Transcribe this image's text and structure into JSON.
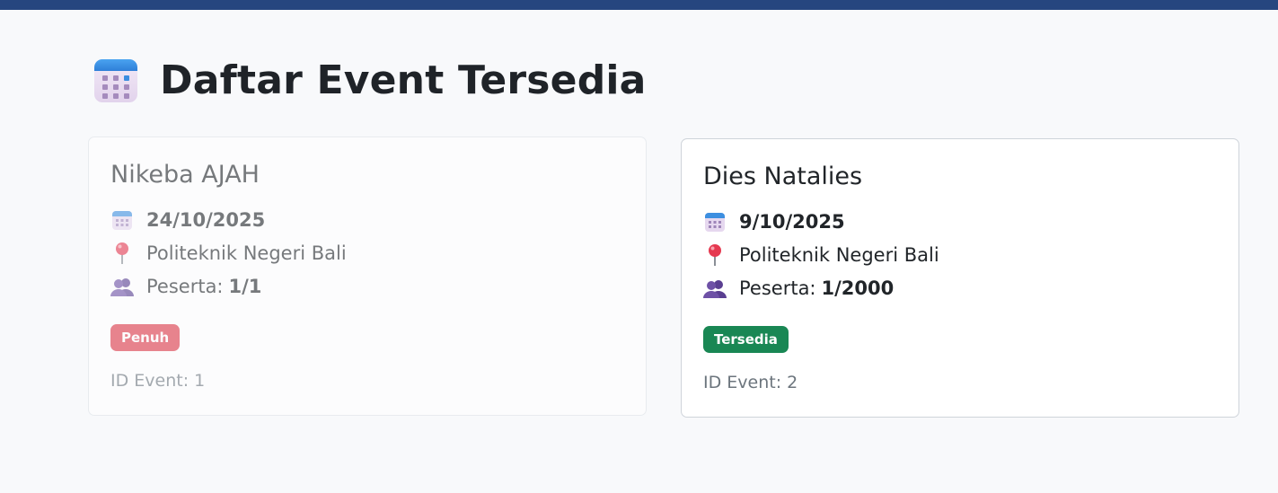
{
  "header": {
    "title": "Daftar Event Tersedia",
    "icon": "calendar-icon"
  },
  "colors": {
    "topbar": "#26467f",
    "badge_full": "#dc3545",
    "badge_available": "#198754"
  },
  "events": [
    {
      "name": "Nikeba AJAH",
      "date": "24/10/2025",
      "location": "Politeknik Negeri Bali",
      "participants_label": "Peserta:",
      "participants": "1/1",
      "status": "Penuh",
      "id_label": "ID Event: 1"
    },
    {
      "name": "Dies Natalies",
      "date": "9/10/2025",
      "location": "Politeknik Negeri Bali",
      "participants_label": "Peserta:",
      "participants": "1/2000",
      "status": "Tersedia",
      "id_label": "ID Event: 2"
    }
  ]
}
